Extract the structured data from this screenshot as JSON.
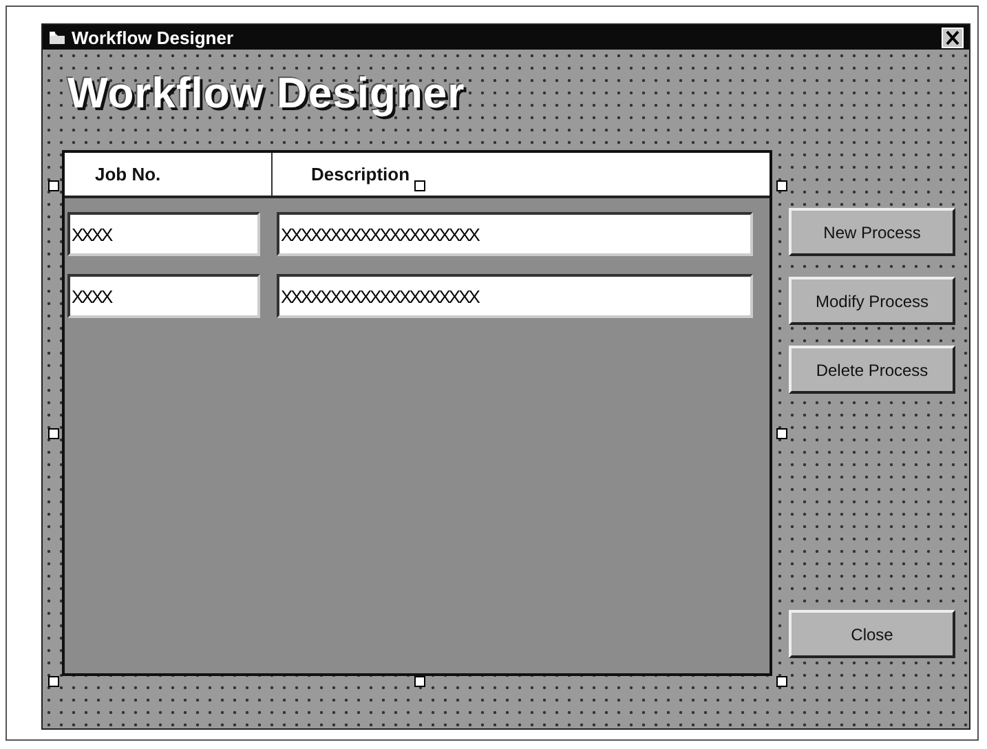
{
  "window": {
    "title": "Workflow Designer"
  },
  "heading": "Workflow Designer",
  "grid": {
    "columns": [
      "Job No.",
      "Description"
    ],
    "rows": [
      [
        "XXXX",
        "XXXXXXXXXXXXXXXXXXXX"
      ],
      [
        "XXXX",
        "XXXXXXXXXXXXXXXXXXXX"
      ]
    ]
  },
  "buttons": [
    {
      "label": "New Process"
    },
    {
      "label": "Modify Process"
    },
    {
      "label": "Delete Process"
    }
  ],
  "close_button": "Close"
}
